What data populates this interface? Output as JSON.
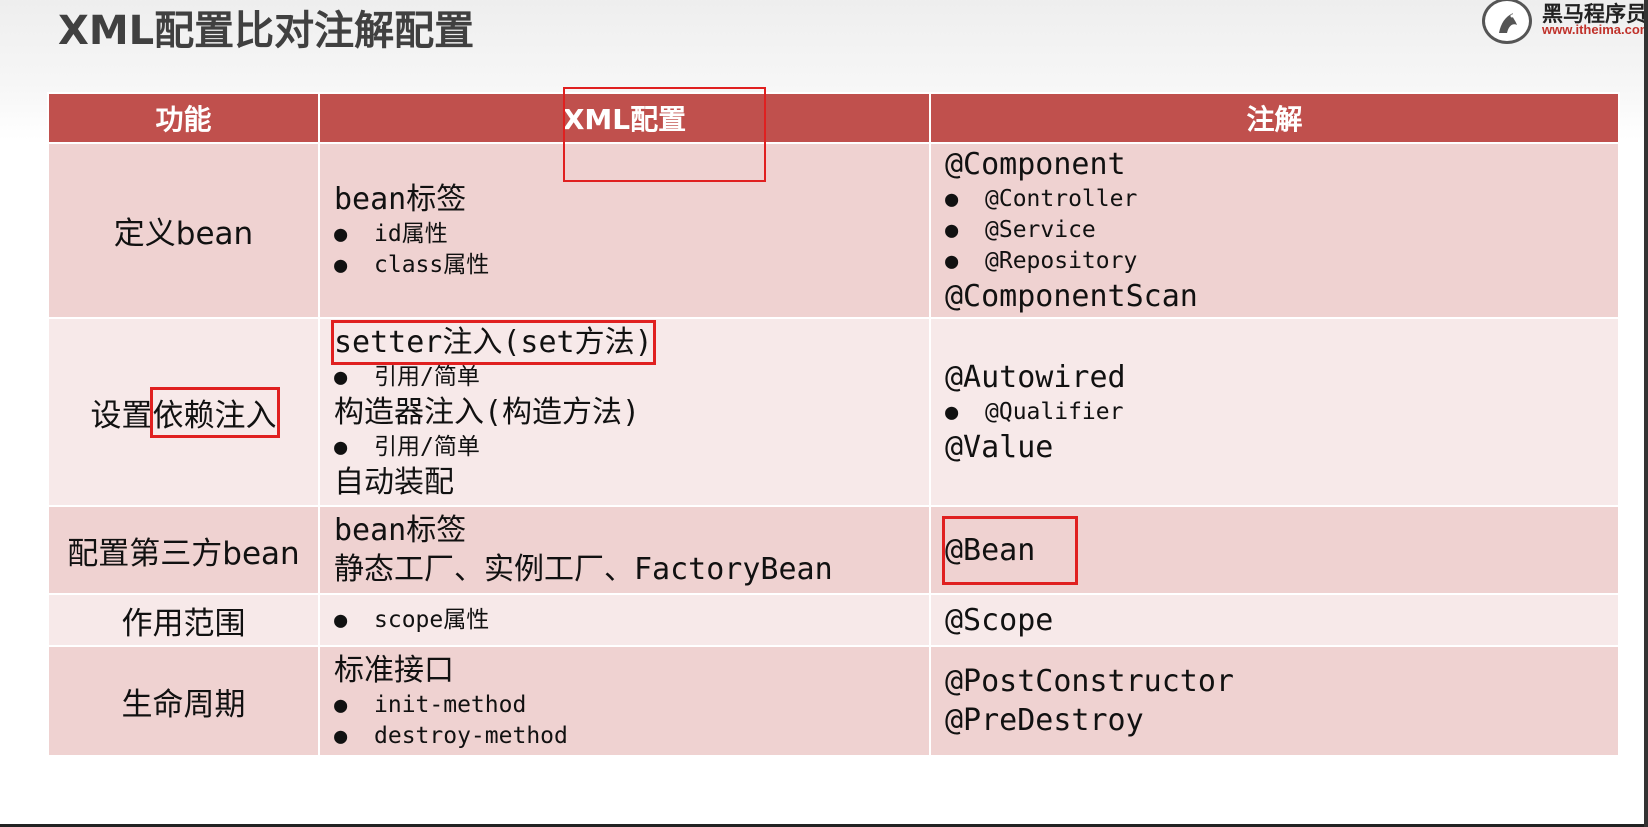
{
  "title": "XML配置比对注解配置",
  "logo": {
    "name": "黑马程序员",
    "url": "www.itheima.com"
  },
  "headers": {
    "feature": "功能",
    "xml": "XML配置",
    "annotation": "注解"
  },
  "rows": [
    {
      "feature": "定义bean",
      "xml": {
        "l1": "bean标签",
        "b1": "id属性",
        "b2": "class属性"
      },
      "ann": {
        "l1": "@Component",
        "b1": "@Controller",
        "b2": "@Service",
        "b3": "@Repository",
        "l2": "@ComponentScan"
      }
    },
    {
      "feature_a": "设置",
      "feature_b": "依赖注入",
      "xml": {
        "l1": "setter注入(set方法)",
        "b1": "引用/简单",
        "l2": "构造器注入(构造方法)",
        "b2": "引用/简单",
        "l3": "自动装配"
      },
      "ann": {
        "l1": "@Autowired",
        "b1": "@Qualifier",
        "l2": "@Value"
      }
    },
    {
      "feature": "配置第三方bean",
      "xml": {
        "l1": "bean标签",
        "l2": "静态工厂、实例工厂、FactoryBean"
      },
      "ann": {
        "l1": "@Bean"
      }
    },
    {
      "feature": "作用范围",
      "xml": {
        "b1": "scope属性"
      },
      "ann": {
        "l1": "@Scope"
      }
    },
    {
      "feature": "生命周期",
      "xml": {
        "l1": "标准接口",
        "b1": "init-method",
        "b2": "destroy-method"
      },
      "ann": {
        "l1": "@PostConstructor",
        "l2": "@PreDestroy"
      }
    }
  ],
  "bullet": "●",
  "colors": {
    "header": "#c0504d",
    "row_dark": "#efd2d1",
    "row_light": "#f7e9e9",
    "highlight": "#e02020"
  }
}
